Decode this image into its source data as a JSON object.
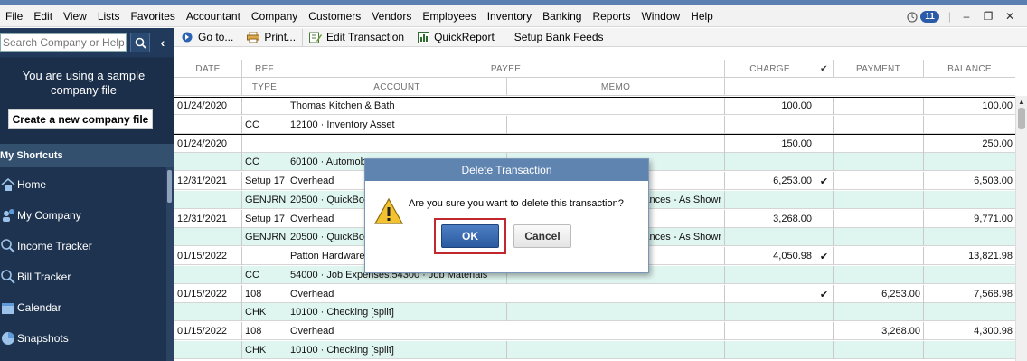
{
  "menubar": {
    "items": [
      "File",
      "Edit",
      "View",
      "Lists",
      "Favorites",
      "Accountant",
      "Company",
      "Customers",
      "Vendors",
      "Employees",
      "Inventory",
      "Banking",
      "Reports",
      "Window",
      "Help"
    ],
    "alert_count": "11"
  },
  "sidebar": {
    "search_placeholder": "Search Company or Help",
    "sample_notice": "You are using a sample company file",
    "create_button": "Create a new company file",
    "shortcuts_header": "My Shortcuts",
    "shortcuts": [
      {
        "label": "Home",
        "icon": "home-icon"
      },
      {
        "label": "My Company",
        "icon": "company-icon"
      },
      {
        "label": "Income Tracker",
        "icon": "income-tracker-icon"
      },
      {
        "label": "Bill Tracker",
        "icon": "bill-tracker-icon"
      },
      {
        "label": "Calendar",
        "icon": "calendar-icon"
      },
      {
        "label": "Snapshots",
        "icon": "snapshots-icon"
      }
    ]
  },
  "toolbar": {
    "goto": "Go to...",
    "print": "Print...",
    "edit": "Edit Transaction",
    "quickreport": "QuickReport",
    "bankfeeds": "Setup Bank Feeds"
  },
  "register": {
    "headers1": {
      "date": "DATE",
      "ref": "REF",
      "payee": "PAYEE",
      "charge": "CHARGE",
      "check": "✔",
      "payment": "PAYMENT",
      "balance": "BALANCE"
    },
    "headers2": {
      "type": "TYPE",
      "account": "ACCOUNT",
      "memo": "MEMO"
    },
    "transactions": [
      {
        "date": "01/24/2020",
        "ref": "",
        "payee": "Thomas Kitchen & Bath",
        "charge": "100.00",
        "check": "",
        "payment": "",
        "balance": "100.00",
        "type": "CC",
        "account": "12100 · Inventory Asset",
        "memo": ""
      },
      {
        "date": "01/24/2020",
        "ref": "",
        "payee": "",
        "charge": "150.00",
        "check": "",
        "payment": "",
        "balance": "250.00",
        "type": "CC",
        "account": "60100 · Automob",
        "memo": ""
      },
      {
        "date": "12/31/2021",
        "ref": "Setup 17",
        "payee": "Overhead",
        "charge": "6,253.00",
        "check": "✔",
        "payment": "",
        "balance": "6,503.00",
        "type": "GENJRN",
        "account": "20500 · QuickBo",
        "memo": "ances - As Showr"
      },
      {
        "date": "12/31/2021",
        "ref": "Setup 17",
        "payee": "Overhead",
        "charge": "3,268.00",
        "check": "",
        "payment": "",
        "balance": "9,771.00",
        "type": "GENJRN",
        "account": "20500 · QuickBo",
        "memo": "ances - As Showr"
      },
      {
        "date": "01/15/2022",
        "ref": "",
        "payee": "Patton Hardware",
        "charge": "4,050.98",
        "check": "✔",
        "payment": "",
        "balance": "13,821.98",
        "type": "CC",
        "account": "54000 · Job Expenses:54300 · Job Materials",
        "memo": ""
      },
      {
        "date": "01/15/2022",
        "ref": "108",
        "payee": "Overhead",
        "charge": "",
        "check": "✔",
        "payment": "6,253.00",
        "balance": "7,568.98",
        "type": "CHK",
        "account": "10100 · Checking [split]",
        "memo": ""
      },
      {
        "date": "01/15/2022",
        "ref": "108",
        "payee": "Overhead",
        "charge": "",
        "check": "",
        "payment": "3,268.00",
        "balance": "4,300.98",
        "type": "CHK",
        "account": "10100 · Checking [split]",
        "memo": ""
      }
    ]
  },
  "dialog": {
    "title": "Delete Transaction",
    "message": "Are you sure you want to delete this transaction?",
    "ok": "OK",
    "cancel": "Cancel"
  },
  "colors": {
    "sidebar_bg": "#1e3350",
    "row_green": "#dff5ef",
    "dialog_title": "#5f84b0",
    "ok_button": "#2a5aa0",
    "highlight_frame": "#c0282e"
  }
}
